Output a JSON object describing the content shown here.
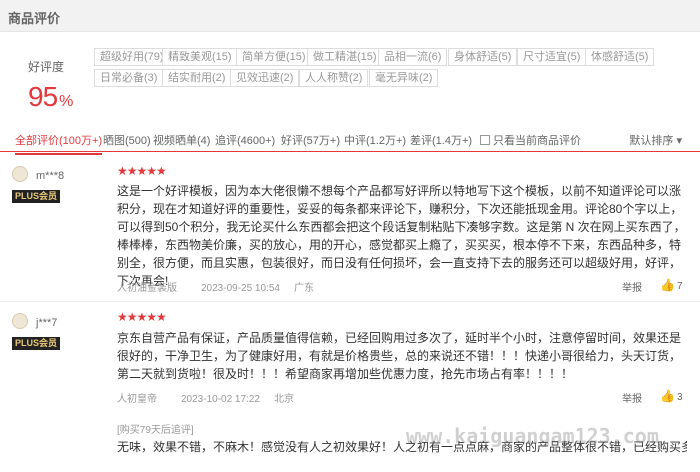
{
  "header": {
    "title": "商品评价"
  },
  "rating": {
    "label": "好评度",
    "value": "95",
    "unit": "%"
  },
  "tags": [
    "超级好用(79)",
    "精致美观(15)",
    "简单方便(15)",
    "做工精湛(15)",
    "品相一流(6)",
    "身体舒适(5)",
    "尺寸适宜(5)",
    "体感舒适(5)",
    "日常必备(3)",
    "结实耐用(2)",
    "见效迅速(2)",
    "人人称赞(2)",
    "毫无异味(2)"
  ],
  "filters": {
    "items": [
      "全部评价(100万+)",
      "晒图(500)",
      "视频晒单(4)",
      "追评(4600+)",
      "好评(57万+)",
      "中评(1.2万+)",
      "差评(1.4万+)"
    ],
    "only_current": "只看当前商品评价",
    "sort": "默认排序 ▾"
  },
  "reviews": [
    {
      "user": "m***8",
      "badge": "PLUS会员",
      "stars": "★★★★★",
      "content": "这是一个好评模板，因为本大佬很懒不想每个产品都写好评所以特地写下这个模板，以前不知道评论可以涨积分，现在才知道好评的重要性，妥妥的每条都来评论下，赚积分，下次还能抵现金用。评论80个字以上，可以得到50个积分，我无论买什么东西都会把这个段话复制粘贴下凑够字数。这是第 N 次在网上买东西了，棒棒棒，东西物美价廉，买的放心，用的开心，感觉都买上瘾了，买买买，根本停不下来，东西品种多，特别全，很方便，而且实惠，包装很好，而日没有任何损坏，会一直支持下去的服务还可以超级好用，好评，下次再会!",
      "product": "人初油金装版",
      "date": "2023-09-25 10:54",
      "location": "广东",
      "report": "举报",
      "likes": "7"
    },
    {
      "user": "j***7",
      "badge": "PLUS会员",
      "stars": "★★★★★",
      "content": "京东自营产品有保证，产品质量值得信赖，已经回购用过多次了，延时半个小时，注意停留时间，效果还是很好的，干净卫生，为了健康好用，有就是价格贵些，总的来说还不错！！！快递小哥很给力，头天订货，第二天就到货啦！很及时！！！希望商家再增加些优惠力度，抢先市场占有率！！！！",
      "product": "人初皇帝",
      "date": "2023-10-02 17:22",
      "location": "北京",
      "report": "举报",
      "likes": "3",
      "followup_tag": "[购买79天后追评]",
      "followup": "无味，效果不错，不麻木！感觉没有人之初效果好！人之初有一点点麻，商家的产品整体很不错，已经购买多次啦！！"
    }
  ],
  "watermark": "www.kaiguangam123.com"
}
